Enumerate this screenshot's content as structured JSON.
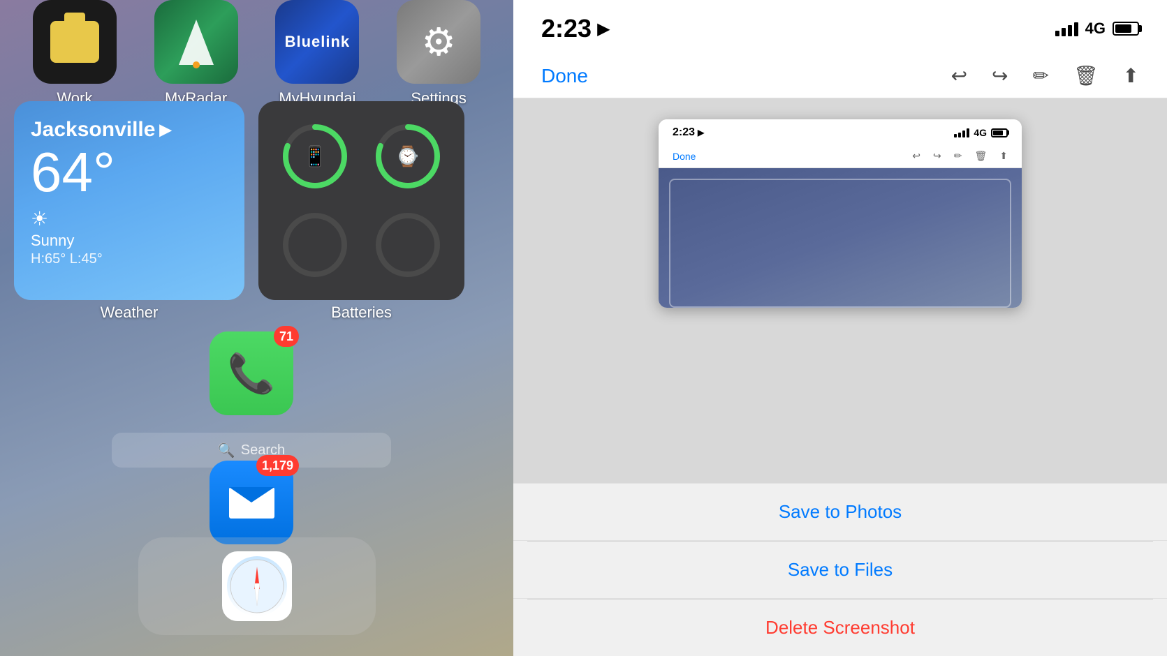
{
  "left": {
    "apps_top": [
      {
        "label": "Work",
        "iconType": "work"
      },
      {
        "label": "MyRadar",
        "iconType": "myradar"
      },
      {
        "label": "MyHyundai",
        "iconType": "bluelink"
      },
      {
        "label": "Settings",
        "iconType": "settings"
      }
    ],
    "weather": {
      "city": "Jacksonville",
      "temp": "64°",
      "icon": "☀",
      "condition": "Sunny",
      "hi_low": "H:65°  L:45°",
      "label": "Weather"
    },
    "batteries": {
      "label": "Batteries"
    },
    "phone": {
      "badge": "71",
      "label": ""
    },
    "search": {
      "text": "Search",
      "icon": "🔍"
    },
    "mail": {
      "badge": "1,179"
    },
    "safari": {
      "label": ""
    }
  },
  "right": {
    "status": {
      "time": "2:23",
      "location_icon": "▶",
      "signal_label": "4G"
    },
    "toolbar": {
      "done_label": "Done"
    },
    "preview": {
      "time": "2:23",
      "done_label": "Done",
      "signal_label": "4G"
    },
    "actions": [
      {
        "label": "Save to Photos",
        "color": "blue",
        "key": "save_photos"
      },
      {
        "label": "Save to Files",
        "color": "blue",
        "key": "save_files"
      },
      {
        "label": "Delete Screenshot",
        "color": "red",
        "key": "delete"
      }
    ]
  }
}
